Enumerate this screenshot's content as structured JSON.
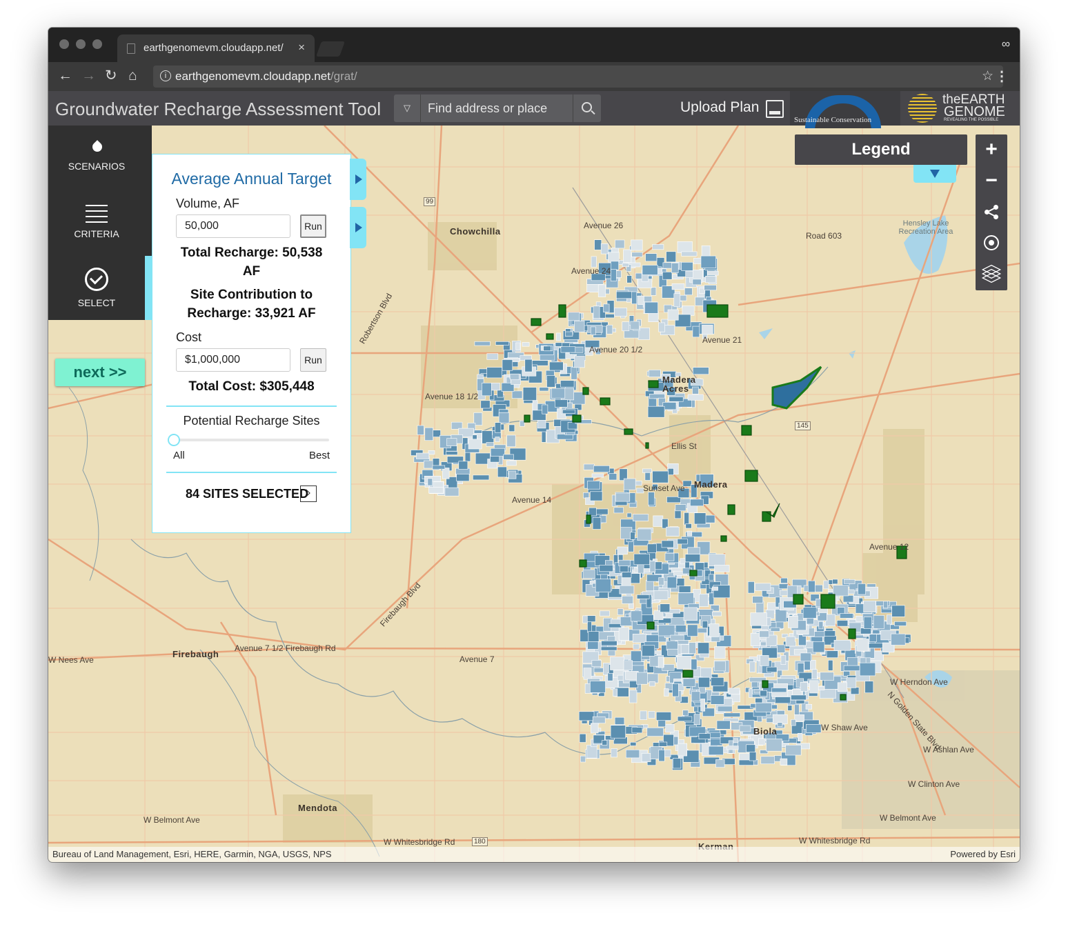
{
  "browser": {
    "tab_title": "earthgenomevm.cloudapp.net/",
    "tab_close": "×",
    "url_host": "earthgenomevm.cloudapp.net",
    "url_path": "/grat/"
  },
  "header": {
    "title": "Groundwater Recharge Assessment Tool",
    "search_placeholder": "Find address or place",
    "upload_label": "Upload Plan",
    "partner_logo_text": "Sustainable Conservation",
    "brand_logo_line1": "theEARTH",
    "brand_logo_line2": "GENOME",
    "brand_logo_line3": "REVEALING THE POSSIBLE"
  },
  "sidebar": {
    "items": [
      {
        "label": "SCENARIOS",
        "icon": "water-drop-icon"
      },
      {
        "label": "CRITERIA",
        "icon": "list-icon"
      },
      {
        "label": "SELECT",
        "icon": "check-circle-icon"
      }
    ],
    "next_label": "next >>"
  },
  "panel": {
    "title": "Average Annual Target",
    "volume_label": "Volume, AF",
    "volume_value": "50,000",
    "run_label": "Run",
    "total_recharge_line1": "Total Recharge: 50,538",
    "total_recharge_line2": "AF",
    "site_contribution_line1": "Site Contribution to",
    "site_contribution_line2": "Recharge: 33,921 AF",
    "cost_label": "Cost",
    "cost_value": "$1,000,000",
    "total_cost": "Total Cost: $305,448",
    "sites_label": "Potential Recharge Sites",
    "slider_min_label": "All",
    "slider_max_label": "Best",
    "slider_value": 0,
    "sites_selected": "84 SITES SELECTED"
  },
  "legend": {
    "title": "Legend"
  },
  "map_controls": {
    "zoom_in": "+",
    "zoom_out": "−"
  },
  "map": {
    "labels": {
      "chowchilla": "Chowchilla",
      "madera_acres": "Madera Acres",
      "madera": "Madera",
      "firebaugh": "Firebaugh",
      "mendota": "Mendota",
      "biola": "Biola",
      "kerman": "Kerman",
      "hensley": "Hensley Lake Recreation Area",
      "avenue26": "Avenue 26",
      "avenue24": "Avenue 24",
      "avenue21": "Avenue 21",
      "avenue20": "Avenue 20 1/2",
      "avenue18": "Avenue 18 1/2",
      "avenue14": "Avenue 14",
      "avenue12": "Avenue 12",
      "avenue7": "Avenue 7",
      "avenue7half": "Avenue 7 1/2 Firebaugh Rd",
      "road603": "Road 603",
      "ellis": "Ellis St",
      "sunset": "Sunset Ave",
      "herndon": "W Herndon Ave",
      "shaw": "W Shaw Ave",
      "ashlan": "W Ashlan Ave",
      "clinton": "W Clinton Ave",
      "belmont_w": "W Belmont Ave",
      "belmont_e": "W Belmont Ave",
      "whitesbridge_w": "W Whitesbridge Rd",
      "whitesbridge_e": "W Whitesbridge Rd",
      "nees": "W Nees Ave",
      "robertson": "Robertson Blvd",
      "firebaugh_blvd": "Firebaugh Blvd",
      "golden_state": "N Golden State Blvd",
      "hwy99": "99",
      "hwy145": "145",
      "hwy180": "180"
    },
    "attribution": "Bureau of Land Management, Esri, HERE, Garmin, NGA, USGS, NPS",
    "powered_by": "Powered by Esri",
    "colors": {
      "land": "#ecdfba",
      "major_road": "#e8a57c",
      "parcel_blue": "#5b8fb0",
      "parcel_light": "#a9c3d5",
      "site_green": "#1a7a1a",
      "water": "#a9d4e8"
    }
  }
}
